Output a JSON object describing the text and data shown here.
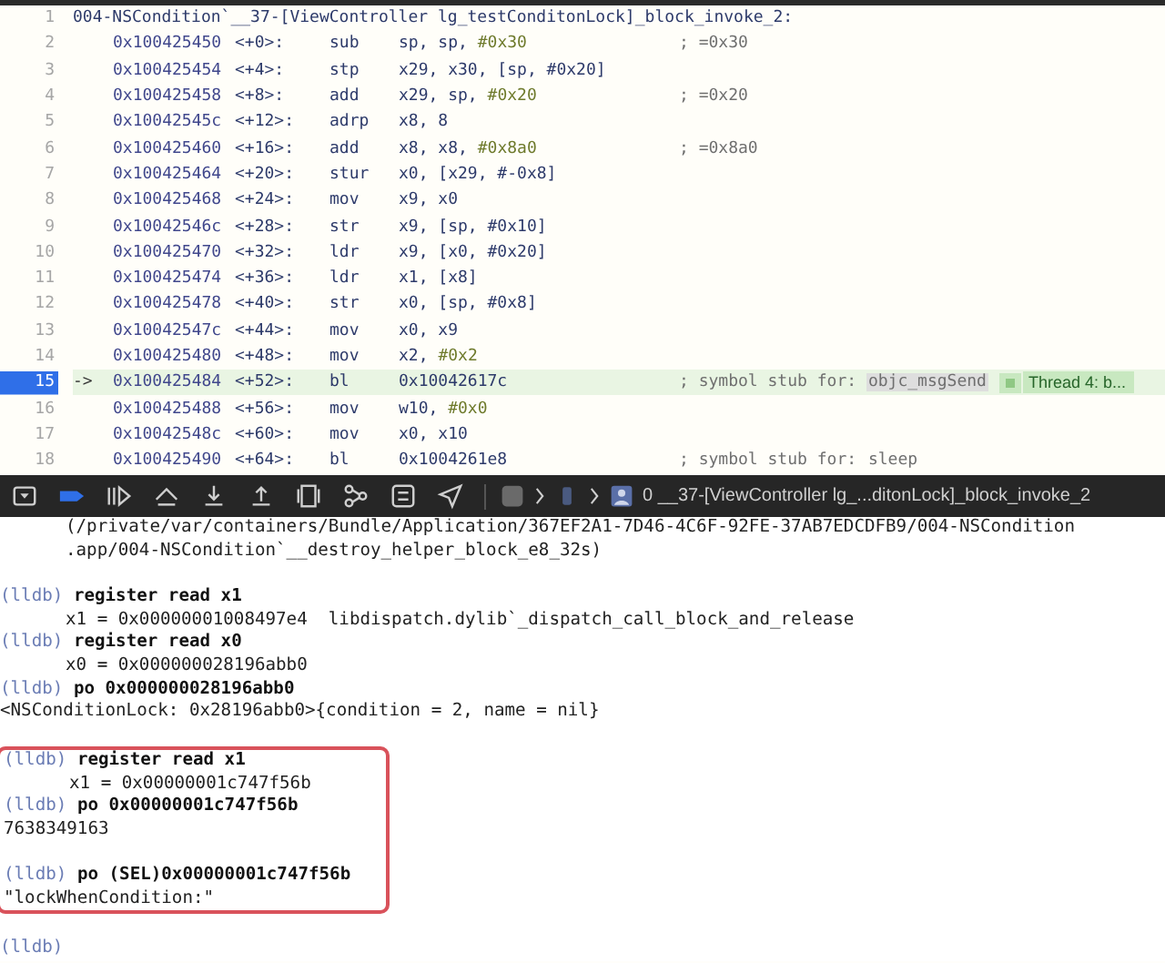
{
  "disassembly": {
    "title": {
      "number": "1",
      "text": "004-NSCondition`__37-[ViewController lg_testConditonLock]_block_invoke_2:"
    },
    "rows": [
      {
        "number": "2",
        "current": false,
        "address": "0x100425450",
        "offset": "<+0>:",
        "mnemonic": "sub",
        "operands": [
          {
            "kind": "reg",
            "text": "sp, sp, "
          },
          {
            "kind": "imm",
            "text": "#0x30"
          }
        ],
        "comment": "; =0x30"
      },
      {
        "number": "3",
        "current": false,
        "address": "0x100425454",
        "offset": "<+4>:",
        "mnemonic": "stp",
        "operands": [
          {
            "kind": "reg",
            "text": "x29, x30, [sp, #0x20]"
          }
        ]
      },
      {
        "number": "4",
        "current": false,
        "address": "0x100425458",
        "offset": "<+8>:",
        "mnemonic": "add",
        "operands": [
          {
            "kind": "reg",
            "text": "x29, sp, "
          },
          {
            "kind": "imm",
            "text": "#0x20"
          }
        ],
        "comment": "; =0x20"
      },
      {
        "number": "5",
        "current": false,
        "address": "0x10042545c",
        "offset": "<+12>:",
        "mnemonic": "adrp",
        "operands": [
          {
            "kind": "reg",
            "text": "x8, 8"
          }
        ]
      },
      {
        "number": "6",
        "current": false,
        "address": "0x100425460",
        "offset": "<+16>:",
        "mnemonic": "add",
        "operands": [
          {
            "kind": "reg",
            "text": "x8, x8, "
          },
          {
            "kind": "imm",
            "text": "#0x8a0"
          }
        ],
        "comment": "; =0x8a0"
      },
      {
        "number": "7",
        "current": false,
        "address": "0x100425464",
        "offset": "<+20>:",
        "mnemonic": "stur",
        "operands": [
          {
            "kind": "reg",
            "text": "x0, [x29, #-0x8]"
          }
        ]
      },
      {
        "number": "8",
        "current": false,
        "address": "0x100425468",
        "offset": "<+24>:",
        "mnemonic": "mov",
        "operands": [
          {
            "kind": "reg",
            "text": "x9, x0"
          }
        ]
      },
      {
        "number": "9",
        "current": false,
        "address": "0x10042546c",
        "offset": "<+28>:",
        "mnemonic": "str",
        "operands": [
          {
            "kind": "reg",
            "text": "x9, [sp, #0x10]"
          }
        ]
      },
      {
        "number": "10",
        "current": false,
        "address": "0x100425470",
        "offset": "<+32>:",
        "mnemonic": "ldr",
        "operands": [
          {
            "kind": "reg",
            "text": "x9, [x0, #0x20]"
          }
        ]
      },
      {
        "number": "11",
        "current": false,
        "address": "0x100425474",
        "offset": "<+36>:",
        "mnemonic": "ldr",
        "operands": [
          {
            "kind": "reg",
            "text": "x1, [x8]"
          }
        ]
      },
      {
        "number": "12",
        "current": false,
        "address": "0x100425478",
        "offset": "<+40>:",
        "mnemonic": "str",
        "operands": [
          {
            "kind": "reg",
            "text": "x0, [sp, #0x8]"
          }
        ]
      },
      {
        "number": "13",
        "current": false,
        "address": "0x10042547c",
        "offset": "<+44>:",
        "mnemonic": "mov",
        "operands": [
          {
            "kind": "reg",
            "text": "x0, x9"
          }
        ]
      },
      {
        "number": "14",
        "current": false,
        "address": "0x100425480",
        "offset": "<+48>:",
        "mnemonic": "mov",
        "operands": [
          {
            "kind": "reg",
            "text": "x2, "
          },
          {
            "kind": "imm",
            "text": "#0x2"
          }
        ]
      },
      {
        "number": "15",
        "current": true,
        "marker": "->",
        "address": "0x100425484",
        "offset": "<+52>:",
        "mnemonic": "bl",
        "operands": [
          {
            "kind": "reg",
            "text": "0x10042617c"
          }
        ],
        "comment": "; symbol stub for: ",
        "symbol": "objc_msgSend",
        "thread": "Thread 4: b..."
      },
      {
        "number": "16",
        "current": false,
        "address": "0x100425488",
        "offset": "<+56>:",
        "mnemonic": "mov",
        "operands": [
          {
            "kind": "reg",
            "text": "w10, "
          },
          {
            "kind": "imm",
            "text": "#0x0"
          }
        ]
      },
      {
        "number": "17",
        "current": false,
        "address": "0x10042548c",
        "offset": "<+60>:",
        "mnemonic": "mov",
        "operands": [
          {
            "kind": "reg",
            "text": "x0, x10"
          }
        ]
      },
      {
        "number": "18",
        "current": false,
        "address": "0x100425490",
        "offset": "<+64>:",
        "mnemonic": "bl",
        "operands": [
          {
            "kind": "reg",
            "text": "0x1004261e8"
          }
        ],
        "comment": "; symbol stub for: ",
        "symbol": "sleep"
      }
    ]
  },
  "debug_bar": {
    "breadcrumb": "0 __37-[ViewController lg_...ditonLock]_block_invoke_2"
  },
  "console": {
    "blocks": [
      {
        "highlighted": false,
        "lines": [
          {
            "kind": "result",
            "text": "(/private/var/containers/Bundle/Application/367EF2A1-7D46-4C6F-92FE-37AB7EDCDFB9/004-NSCondition"
          },
          {
            "kind": "result",
            "text": ".app/004-NSCondition`__destroy_helper_block_e8_32s)"
          },
          {
            "kind": "blank"
          },
          {
            "kind": "prompt",
            "prompt": "(lldb)",
            "command": "register read x1"
          },
          {
            "kind": "result",
            "text": "x1 = 0x00000001008497e4  libdispatch.dylib`_dispatch_call_block_and_release"
          },
          {
            "kind": "prompt",
            "prompt": "(lldb)",
            "command": "register read x0"
          },
          {
            "kind": "result",
            "text": "x0 = 0x000000028196abb0"
          },
          {
            "kind": "prompt",
            "prompt": "(lldb)",
            "command": "po 0x000000028196abb0"
          },
          {
            "kind": "output",
            "text": "<NSConditionLock: 0x28196abb0>{condition = 2, name = nil}"
          },
          {
            "kind": "blank"
          }
        ]
      },
      {
        "highlighted": true,
        "lines": [
          {
            "kind": "prompt",
            "prompt": "(lldb)",
            "command": "register read x1"
          },
          {
            "kind": "result",
            "text": "x1 = 0x00000001c747f56b"
          },
          {
            "kind": "prompt",
            "prompt": "(lldb)",
            "command": "po 0x00000001c747f56b"
          },
          {
            "kind": "output",
            "text": "7638349163"
          },
          {
            "kind": "blank"
          },
          {
            "kind": "prompt",
            "prompt": "(lldb)",
            "command": "po (SEL)0x00000001c747f56b"
          },
          {
            "kind": "output",
            "text": "\"lockWhenCondition:\""
          }
        ]
      },
      {
        "highlighted": false,
        "lines": [
          {
            "kind": "blank"
          },
          {
            "kind": "prompt",
            "prompt": "(lldb)"
          }
        ]
      }
    ]
  }
}
